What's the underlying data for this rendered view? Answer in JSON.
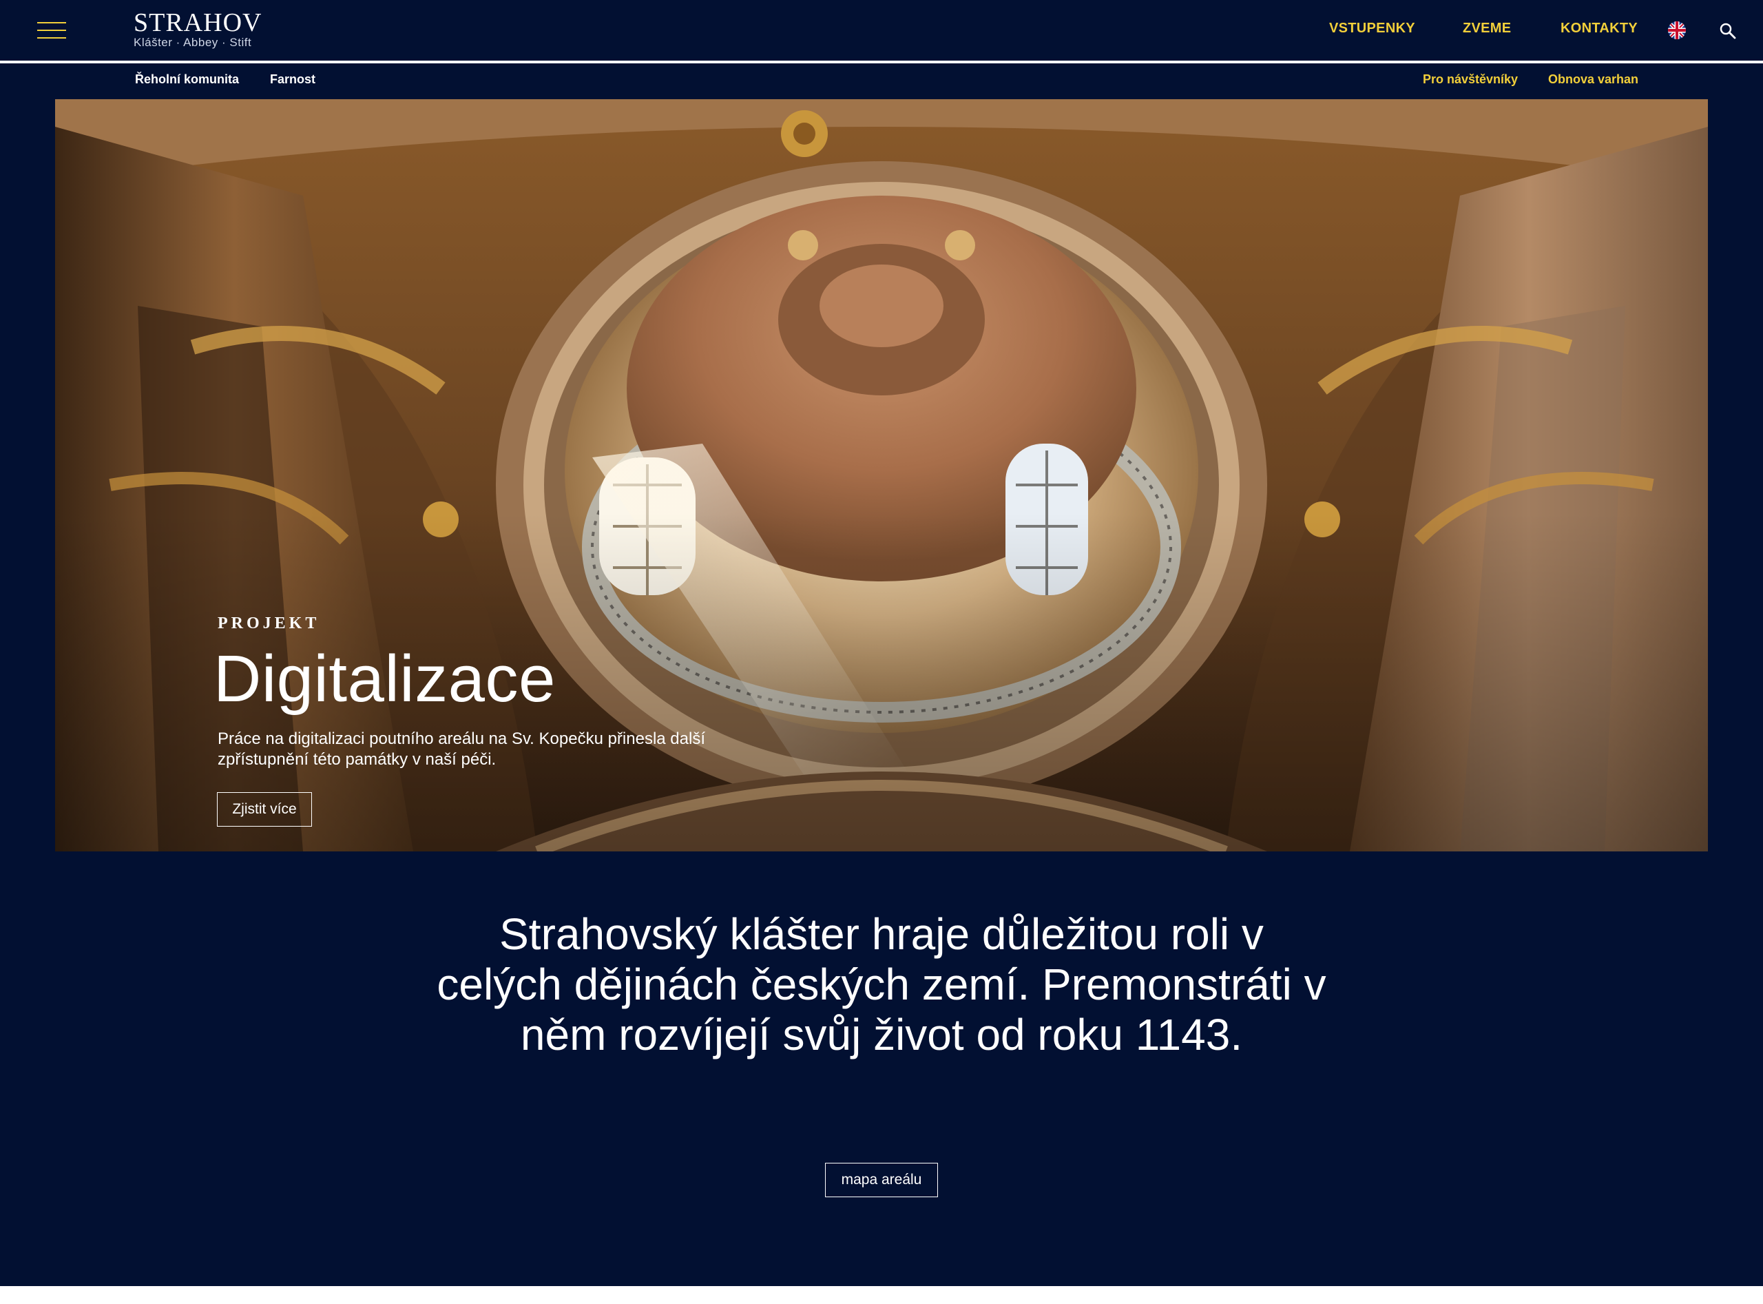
{
  "header": {
    "logo": {
      "word": "STRAHOV",
      "subtitle": "Klášter · Abbey · Stift"
    },
    "nav": [
      {
        "label": "VSTUPENKY"
      },
      {
        "label": "ZVEME"
      },
      {
        "label": "KONTAKTY"
      }
    ],
    "icons": {
      "menu": "hamburger-menu-icon",
      "language": "uk-flag-icon",
      "search": "search-icon"
    }
  },
  "subnav": {
    "left": [
      {
        "label": "Řeholní komunita"
      },
      {
        "label": "Farnost"
      }
    ],
    "right": [
      {
        "label": "Pro návštěvníky"
      },
      {
        "label": "Obnova varhan"
      }
    ]
  },
  "hero": {
    "eyebrow": "PROJEKT",
    "title": "Digitalizace",
    "description": "Práce na digitalizaci poutního areálu na Sv. Kopečku přinesla další zpřístupnění této památky v naší péči.",
    "cta": "Zjistit více"
  },
  "intro": {
    "text": "Strahovský klášter hraje důležitou roli v celých dějinách českých zemí. Premonstráti v něm rozvíjejí svůj život od roku 1143.",
    "button": "mapa areálu"
  },
  "colors": {
    "background": "#021032",
    "accent": "#f2cf3a",
    "text": "#ffffff"
  }
}
